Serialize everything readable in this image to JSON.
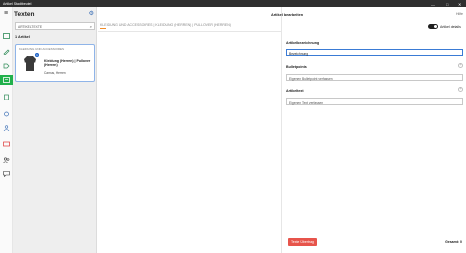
{
  "window": {
    "app_title": "Artikel Stadtbeutel",
    "minimize": "—",
    "maximize": "□",
    "close": "✕"
  },
  "rail": {
    "icons": [
      "home-icon",
      "edit-icon",
      "tag-icon",
      "texts-icon",
      "delete-icon",
      "share-icon",
      "users-icon",
      "box-icon",
      "people-icon",
      "chat-icon"
    ]
  },
  "sidebar": {
    "title": "Texten",
    "search_placeholder": "ARTIKELTEXTE",
    "count_label": "1 Artikel",
    "card": {
      "category": "KLEIDUNG UND ACCESSOIRES",
      "badge": "1",
      "name": "Kleidung (Herren) | Pullover (Herren)",
      "subtitle": "Camus, Herren"
    }
  },
  "middle": {
    "breadcrumb": "KLEIDUNG UND ACCESSOIRES  |  KLEIDUNG (HERREN)  |  PULLOVER (HERREN)"
  },
  "detail": {
    "title": "Artikel bearbeiten",
    "help": "Hilfe",
    "toggle_label": "Artikel details",
    "sections": [
      {
        "label": "Artikelbezeichnung",
        "value": "Bezeichnung",
        "placeholder": ""
      },
      {
        "label": "Bulletpoints",
        "value": "",
        "placeholder": "Eigenen Bulletpoint verfassen"
      },
      {
        "label": "Artikeltext",
        "value": "",
        "placeholder": "Eigenen Text verfassen"
      }
    ],
    "save_button": "Texte Übertrag",
    "total_label": "Gesamt: 0"
  },
  "colors": {
    "accent_green": "#21b04b",
    "save_red": "#e7544b",
    "selection_blue": "#3a7bd5",
    "breadcrumb_underline": "#f28c28"
  }
}
